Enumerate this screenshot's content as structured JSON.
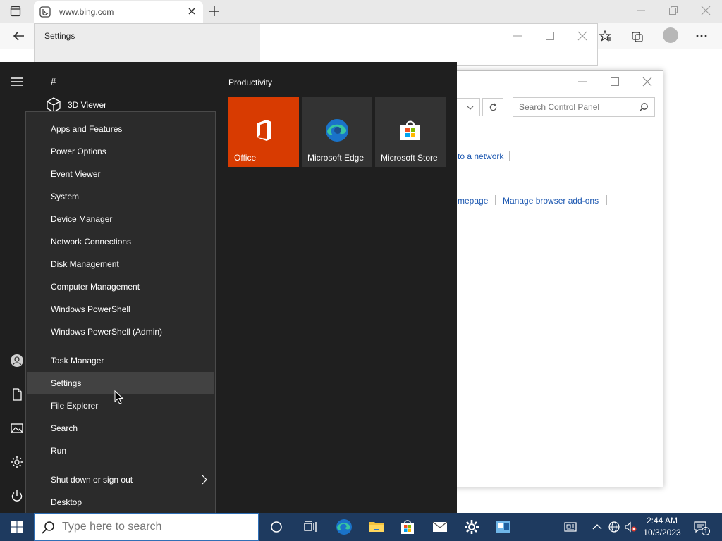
{
  "browser": {
    "tab_title": "www.bing.com"
  },
  "settings_window": {
    "title": "Settings"
  },
  "control_panel": {
    "search_placeholder": "Search Control Panel",
    "link_network": "to a network",
    "link_homepage": "mepage",
    "link_addons": "Manage browser add-ons"
  },
  "start_menu": {
    "letter_group": "#",
    "apps": [
      {
        "label": "3D Viewer",
        "icon": "cube-icon"
      }
    ],
    "tiles_group": "Productivity",
    "tiles": [
      {
        "label": "Office",
        "icon": "office-icon",
        "color": "#d83b01"
      },
      {
        "label": "Microsoft Edge",
        "icon": "edge-icon",
        "color": "#333333"
      },
      {
        "label": "Microsoft Store",
        "icon": "store-icon",
        "color": "#333333"
      }
    ]
  },
  "winx_menu": {
    "items": [
      "Apps and Features",
      "Power Options",
      "Event Viewer",
      "System",
      "Device Manager",
      "Network Connections",
      "Disk Management",
      "Computer Management",
      "Windows PowerShell",
      "Windows PowerShell (Admin)",
      "Task Manager",
      "Settings",
      "File Explorer",
      "Search",
      "Run",
      "Shut down or sign out",
      "Desktop"
    ],
    "hovered": "Settings"
  },
  "taskbar": {
    "search_placeholder": "Type here to search",
    "time": "2:44 AM",
    "date": "10/3/2023",
    "notification_count": "1"
  },
  "colors": {
    "start_bg": "#1f1f1f",
    "menu_bg": "#2b2b2b",
    "office_tile": "#d83b01",
    "taskbar": "#1e3a5f",
    "link": "#1a56b0"
  }
}
